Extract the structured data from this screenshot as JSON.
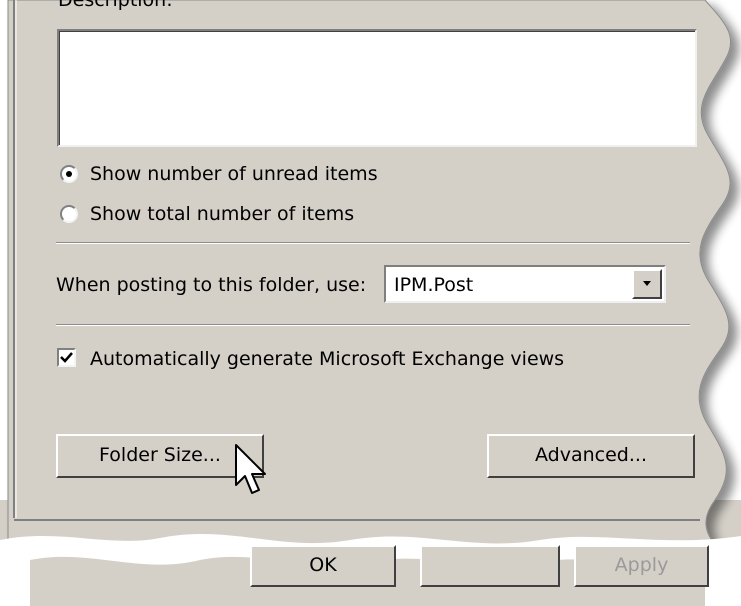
{
  "dialog": {
    "description_label": "Description:",
    "description_value": "",
    "radio_unread_label": "Show number of unread items",
    "radio_total_label": "Show total number of items",
    "radio_selected": "unread",
    "posting_label": "When posting to this folder, use:",
    "posting_value": "IPM.Post",
    "checkbox_label": "Automatically generate Microsoft Exchange views",
    "checkbox_checked": true,
    "folder_size_button": "Folder Size...",
    "advanced_button": "Advanced...",
    "ok_button": "OK",
    "apply_button": "Apply",
    "icons": {
      "dropdown": "chevron-down-icon",
      "cursor": "mouse-pointer-icon",
      "check": "checkmark-icon"
    }
  }
}
